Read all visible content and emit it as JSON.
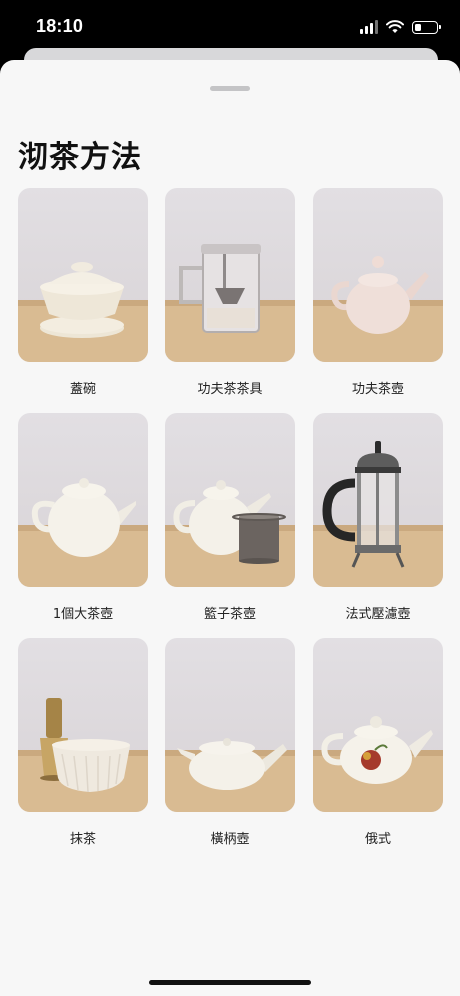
{
  "status_bar": {
    "time": "18:10",
    "icons": [
      "cellular-signal-icon",
      "wifi-icon",
      "battery-icon"
    ],
    "battery_level": 0.35
  },
  "sheet": {
    "title": "沏茶方法",
    "items": [
      {
        "label": "蓋碗",
        "icon": "gaiwan-icon"
      },
      {
        "label": "功夫茶茶具",
        "icon": "gongfu-tea-set-icon"
      },
      {
        "label": "功夫茶壺",
        "icon": "gongfu-teapot-icon"
      },
      {
        "label": "1個大茶壺",
        "icon": "large-teapot-icon"
      },
      {
        "label": "籃子茶壺",
        "icon": "basket-teapot-icon"
      },
      {
        "label": "法式壓濾壺",
        "icon": "french-press-icon"
      },
      {
        "label": "抹茶",
        "icon": "matcha-icon"
      },
      {
        "label": "橫柄壺",
        "icon": "kyusu-teapot-icon"
      },
      {
        "label": "俄式",
        "icon": "russian-teapot-icon"
      }
    ]
  },
  "colors": {
    "sheet_background": "#f7f7f7",
    "table_wood": "#d6b890",
    "photo_backdrop": "#ddd8dc"
  }
}
